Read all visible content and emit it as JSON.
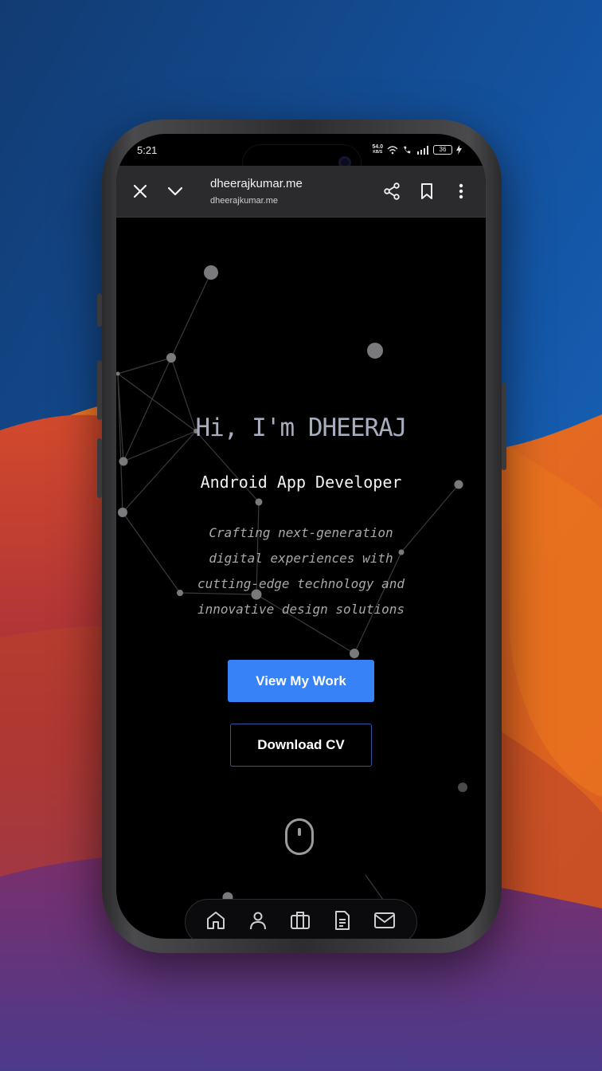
{
  "status_bar": {
    "time": "5:21",
    "network_speed": "54.0",
    "network_speed_unit": "KB/S",
    "battery_level": "36"
  },
  "browser": {
    "page_title": "dheerajkumar.me",
    "url": "dheerajkumar.me",
    "icons": [
      "close-icon",
      "chevron-down-icon",
      "share-icon",
      "bookmark-icon",
      "more-vertical-icon"
    ]
  },
  "hero": {
    "title": "Hi, I'm DHEERAJ",
    "subtitle": "Android App Developer",
    "description": "Crafting next-generation digital experiences with cutting-edge technology and innovative design solutions",
    "primary_button": "View My Work",
    "secondary_button": "Download CV",
    "scroll_icon": "mouse-icon"
  },
  "bottom_nav": {
    "items": [
      "home-icon",
      "user-icon",
      "briefcase-icon",
      "document-icon",
      "mail-icon"
    ]
  },
  "colors": {
    "accent": "#3682f6",
    "background": "#000000",
    "title_text": "#a7adbd",
    "toolbar": "#2b2b2d"
  }
}
